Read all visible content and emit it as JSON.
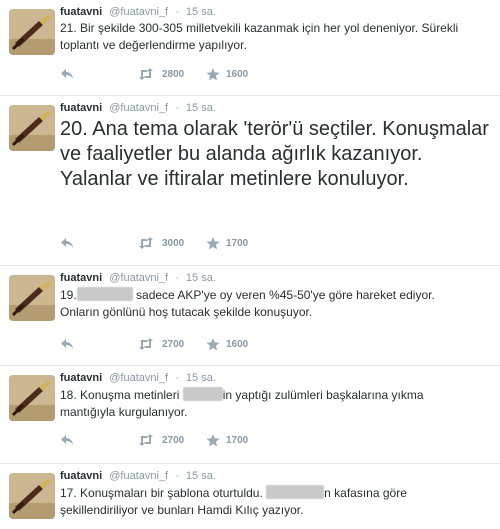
{
  "author": {
    "fullname": "fuatavni",
    "username": "@fuatavni_f",
    "dot": "·"
  },
  "tweets": [
    {
      "time": "15 sa.",
      "text": "21. Bir şekilde 300-305 milletvekili kazanmak için her yol deneniyor. Sürekli toplantı ve değerlendirme yapılıyor.",
      "retweets": "2800",
      "favorites": "1600"
    },
    {
      "time": "15 sa.",
      "text": "20. Ana tema olarak 'terör'ü seçtiler. Konuşmalar ve faaliyetler bu alanda ağırlık kazanıyor. Yalanlar ve iftiralar metinlere konuluyor.",
      "retweets": "3000",
      "favorites": "1700"
    },
    {
      "time": "15 sa.",
      "text_parts": [
        "19.",
        " sadece AKP'ye oy veren %45-50'ye göre hareket ediyor.",
        "Onların gönlünü hoş tutacak şekilde konuşuyor."
      ],
      "retweets": "2700",
      "favorites": "1600"
    },
    {
      "time": "15 sa.",
      "text_parts": [
        "18. Konuşma metinleri",
        "in yaptığı zulümleri başkalarına yıkma",
        "mantığıyla kurgulanıyor."
      ],
      "retweets": "2700",
      "favorites": "1700"
    },
    {
      "time": "15 sa.",
      "text_parts": [
        "17. Konuşmaları bir şablona oturtuldu.",
        "n kafasına göre",
        "şekillendiriliyor ve bunları Hamdi Kılıç yazıyor."
      ]
    }
  ],
  "icons": {
    "reply": "reply-arrow-icon",
    "retweet": "retweet-icon",
    "favorite": "star-icon",
    "avatar": "fountain-pen-icon"
  },
  "colors": {
    "text": "#292f33",
    "muted": "#8899a6",
    "divider": "#e1e8ed"
  }
}
